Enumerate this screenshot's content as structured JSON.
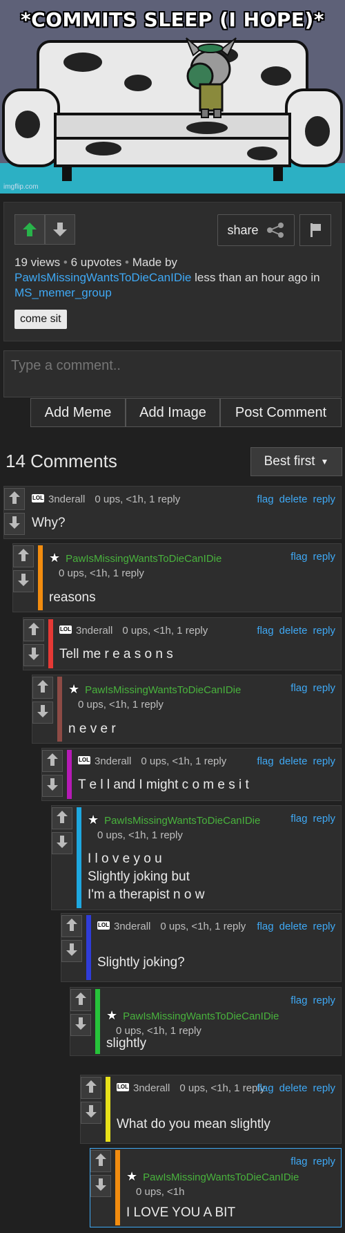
{
  "meme": {
    "title": "*COMMITS SLEEP (I HOPE)*",
    "watermark": "imgflip.com"
  },
  "post": {
    "share_label": "share",
    "views": "19 views",
    "upvotes": "6 upvotes",
    "made_by": "Made by",
    "author": "PawIsMissingWantsToDieCanIDie",
    "time": "less than an hour ago in",
    "stream": "MS_memer_group",
    "tag": "come sit"
  },
  "composer": {
    "placeholder": "Type a comment..",
    "add_meme": "Add Meme",
    "add_image": "Add Image",
    "post_comment": "Post Comment"
  },
  "comments_header": {
    "count_label": "14 Comments",
    "sort_label": "Best first"
  },
  "actions": {
    "flag": "flag",
    "delete": "delete",
    "reply": "reply"
  },
  "colors": {
    "upvote_active": "#28b34a",
    "link": "#3fa9f5",
    "op_name": "#49b33d"
  },
  "comments": [
    {
      "user": "3nderall",
      "meta": "0 ups, <1h, 1 reply",
      "text": "Why?",
      "bar_color": ""
    },
    {
      "user": "PawIsMissingWantsToDieCanIDie",
      "meta": "0 ups, <1h, 1 reply",
      "text": "reasons",
      "bar_color": "#f28c0f"
    },
    {
      "user": "3nderall",
      "meta": "0 ups, <1h, 1 reply",
      "text": "Tell me r e a s o n s",
      "bar_color": "#e53935"
    },
    {
      "user": "PawIsMissingWantsToDieCanIDie",
      "meta": "0 ups, <1h, 1 reply",
      "text": "n e v e r",
      "bar_color": "#8d4b45"
    },
    {
      "user": "3nderall",
      "meta": "0 ups, <1h, 1 reply",
      "text": "T e l l and I might c o m e s i t",
      "bar_color": "#b61bb6"
    },
    {
      "user": "PawIsMissingWantsToDieCanIDie",
      "meta": "0 ups, <1h, 1 reply",
      "text": "I l o v e y o u\nSlightly joking but\nI'm a therapist n o w",
      "bar_color": "#1ea8e0"
    },
    {
      "user": "3nderall",
      "meta": "0 ups, <1h, 1 reply",
      "text": "Slightly joking?",
      "bar_color": "#2f3cd8"
    },
    {
      "user": "PawIsMissingWantsToDieCanIDie",
      "meta": "0 ups, <1h, 1 reply",
      "text": "slightly",
      "bar_color": "#26c33a"
    },
    {
      "user": "3nderall",
      "meta": "0 ups, <1h, 1 reply",
      "text": "What do you mean slightly",
      "bar_color": "#e8e11a"
    },
    {
      "user": "PawIsMissingWantsToDieCanIDie",
      "meta": "0 ups, <1h",
      "text": "I LOVE YOU A BIT",
      "bar_color": "#f28c0f"
    }
  ]
}
